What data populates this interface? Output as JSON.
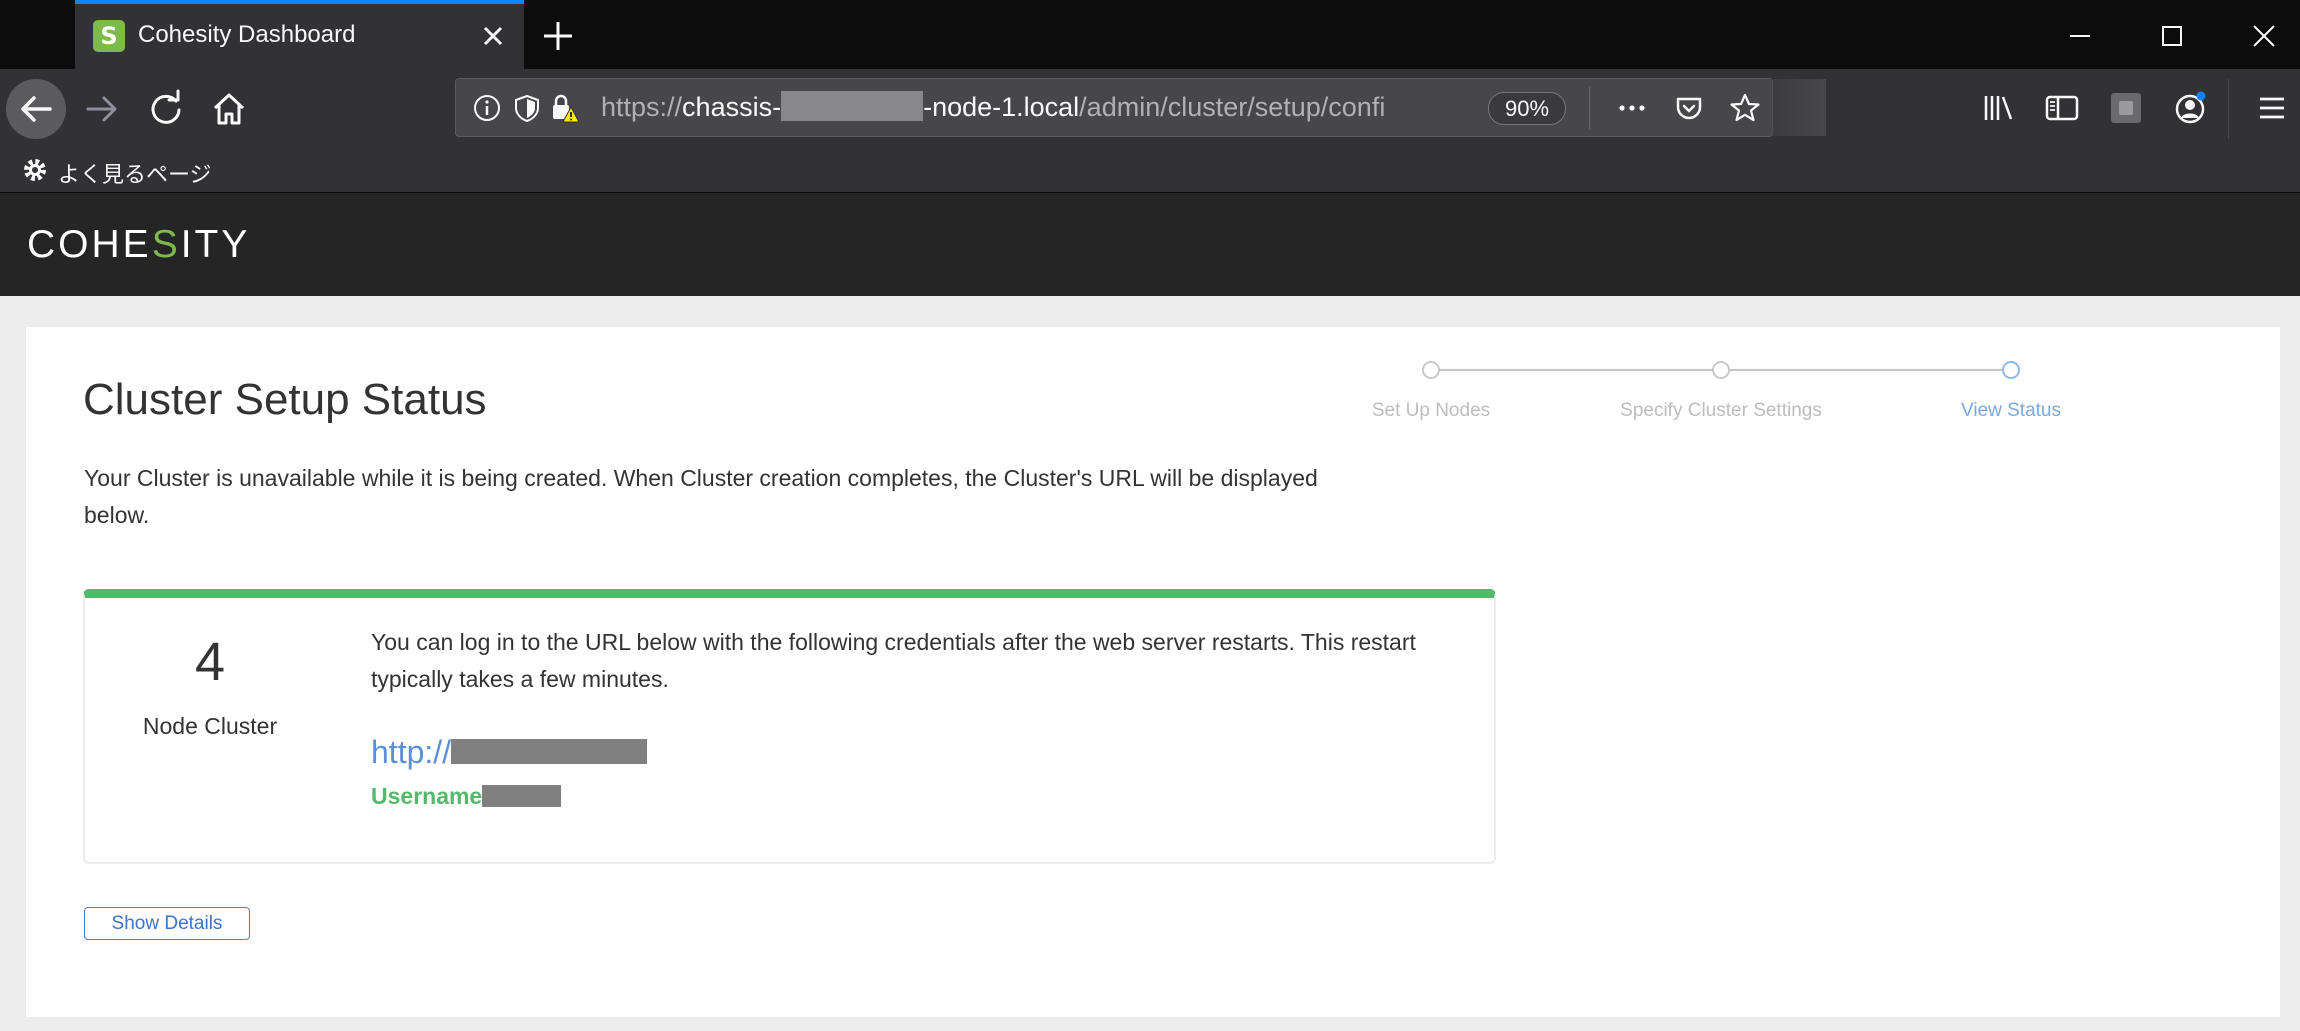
{
  "browser": {
    "tab_title": "Cohesity Dashboard",
    "favicon_letter": "S",
    "url": {
      "scheme": "https://",
      "host_start": "chassis-",
      "host_end": "-node-1.local",
      "path": "/admin/cluster/setup/confi"
    },
    "zoom": "90%",
    "bookmark_label": "よく見るページ"
  },
  "app": {
    "logo_before": "COHE",
    "logo_s": "S",
    "logo_after": "ITY"
  },
  "page": {
    "title": "Cluster Setup Status",
    "intro": "Your Cluster is unavailable while it is being created. When Cluster creation completes, the Cluster's URL will be displayed below.",
    "steps": [
      {
        "label": "Set Up Nodes",
        "active": false
      },
      {
        "label": "Specify Cluster Settings",
        "active": false
      },
      {
        "label": "View Status",
        "active": true
      }
    ],
    "status": {
      "node_count": "4",
      "node_label": "Node Cluster",
      "message": "You can log in to the URL below with the following credentials after the web server restarts. This restart typically takes a few minutes.",
      "url_prefix": "http://",
      "username_label": "Username"
    },
    "show_details_label": "Show Details"
  },
  "colors": {
    "accent_green": "#55b96b",
    "brand_green": "#7cba4c",
    "link_blue": "#5b8fd6",
    "firefox_blue": "#0a84ff"
  }
}
